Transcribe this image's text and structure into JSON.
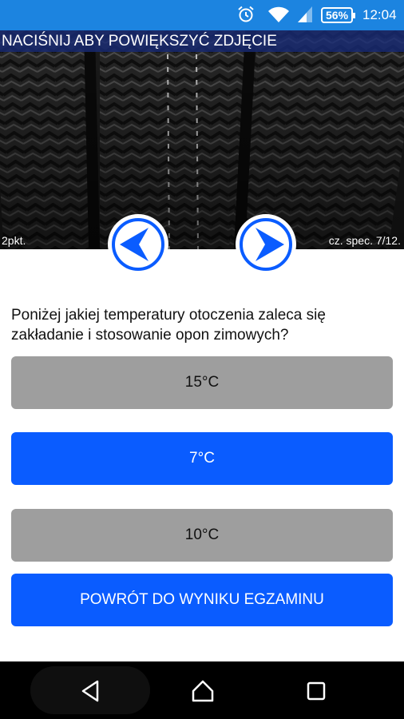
{
  "status_bar": {
    "battery_level": "56%",
    "time": "12:04",
    "icons": [
      "alarm-icon",
      "wifi-icon",
      "signal-icon"
    ],
    "background_color": "#1c84e0"
  },
  "photo": {
    "banner_text": "NACIŚNIJ ABY POWIĘKSZYĆ ZDJĘCIE",
    "points_text": "2pkt.",
    "progress_text": "cz. spec. 7/12."
  },
  "question": {
    "text": "Poniżej jakiej temperatury otoczenia zaleca się zakładanie i stosowanie opon zimowych?"
  },
  "answers": [
    {
      "label": "15°C",
      "color": "#9e9e9e"
    },
    {
      "label": "7°C",
      "color": "#0a5cff"
    },
    {
      "label": "10°C",
      "color": "#9e9e9e"
    }
  ],
  "back_button": {
    "label": "POWRÓT DO WYNIKU EGZAMINU",
    "color": "#0a5cff"
  },
  "navigation": {
    "icons": [
      "back-icon",
      "home-icon",
      "recent-apps-icon"
    ]
  }
}
